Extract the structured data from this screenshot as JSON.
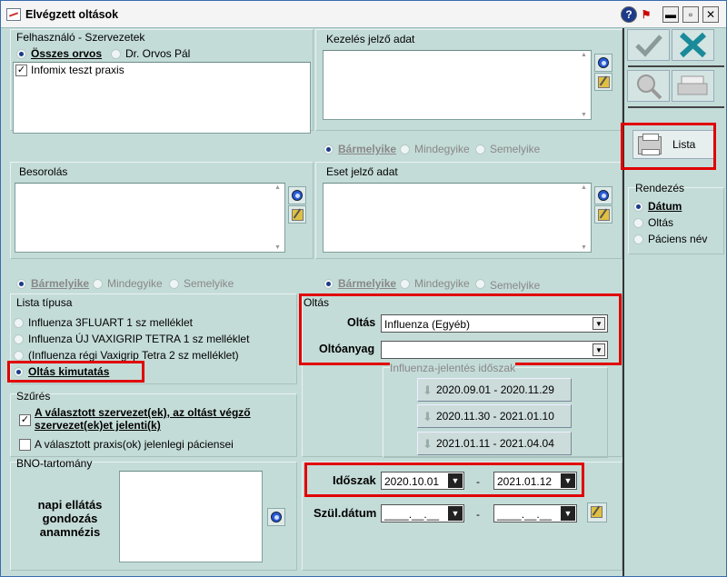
{
  "window": {
    "title": "Elvégzett oltások"
  },
  "felhasznalo": {
    "label": "Felhasználó - Szervezetek",
    "radio_all": "Összes orvos",
    "radio_doctor": "Dr. Orvos Pál",
    "list_item": "Infomix teszt praxis"
  },
  "kezeles": {
    "label": "Kezelés jelző adat"
  },
  "eset": {
    "label": "Eset jelző adat"
  },
  "besorolas": {
    "label": "Besorolás"
  },
  "match": {
    "any": "Bármelyike",
    "all": "Mindegyike",
    "none": "Semelyike"
  },
  "lista_tipusa": {
    "label": "Lista típusa",
    "options": [
      "Influenza 3FLUART 1 sz melléklet",
      "Influenza ÚJ VAXIGRIP TETRA 1 sz melléklet",
      "(Influenza régi Vaxigrip Tetra 2 sz melléklet)",
      "Oltás kimutatás"
    ]
  },
  "oltas": {
    "label": "Oltás",
    "oltas_label": "Oltás",
    "oltas_value": "Influenza (Egyéb)",
    "oltoanyag_label": "Oltóanyag",
    "oltoanyag_value": "",
    "period_label": "Influenza-jelentés időszak",
    "periods": [
      "2020.09.01 - 2020.11.29",
      "2020.11.30 - 2021.01.10",
      "2021.01.11 - 2021.04.04"
    ]
  },
  "szures": {
    "label": "Szűrés",
    "opt1": "A választott szervezet(ek), az oltást végző szervezet(ek)et jelenti(k)",
    "opt2": "A választott praxis(ok) jelenlegi páciensei"
  },
  "bno": {
    "label": "BNO-tartomány",
    "text1": "napi ellátás",
    "text2": "gondozás",
    "text3": "anamnézis"
  },
  "idoszak": {
    "label": "Időszak",
    "from": "2020.10.01",
    "to": "2021.01.12",
    "dash": "-"
  },
  "szul": {
    "label": "Szül.dátum",
    "from": "____.__.__",
    "to": "____.__.__",
    "dash": "-"
  },
  "right": {
    "lista_label": "Lista",
    "rendezes_label": "Rendezés",
    "sort_options": [
      "Dátum",
      "Oltás",
      "Páciens név"
    ]
  }
}
